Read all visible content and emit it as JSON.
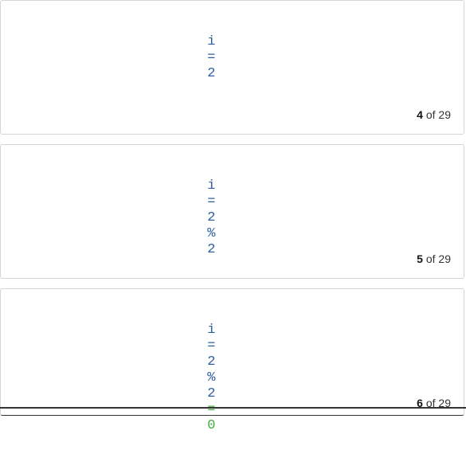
{
  "colors": {
    "code_default": "#2f5f9f",
    "code_result": "#3fae3f",
    "border": "#d5d5d5"
  },
  "slides": [
    {
      "tokens": [
        "i",
        "=",
        "2"
      ],
      "result": "",
      "current": "4",
      "of_label": "of",
      "total": "29"
    },
    {
      "tokens": [
        "i",
        "=",
        "2",
        "%",
        "2"
      ],
      "result": "",
      "current": "5",
      "of_label": "of",
      "total": "29"
    },
    {
      "tokens": [
        "i",
        "=",
        "2",
        "%",
        "2",
        "="
      ],
      "result": "0",
      "current": "6",
      "of_label": "of",
      "total": "29"
    }
  ]
}
